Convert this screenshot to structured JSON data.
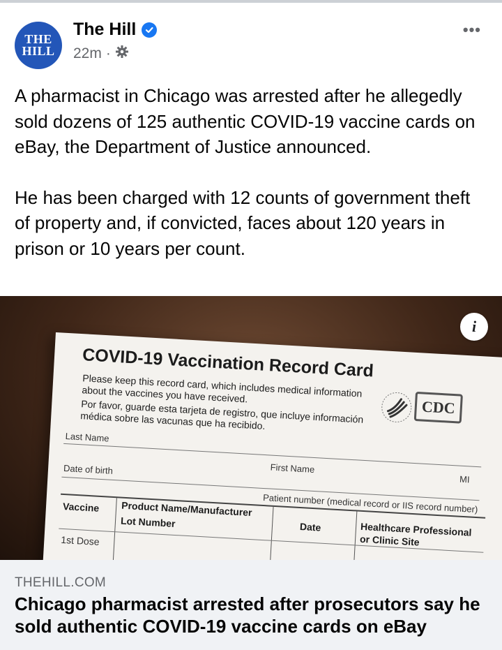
{
  "post": {
    "page_name": "The Hill",
    "avatar_line1": "THE",
    "avatar_line2": "HILL",
    "time": "22m",
    "more_label": "•••",
    "text_para1": "A pharmacist in Chicago was arrested after he allegedly sold dozens of 125 authentic COVID-19 vaccine cards on eBay, the Department of Justice announced.",
    "text_para2": "He has been charged with 12 counts of government theft of property and, if convicted, faces about 120 years in prison or 10 years per count."
  },
  "image": {
    "info_label": "i",
    "card_title": "COVID-19 Vaccination Record Card",
    "card_en": "Please keep this record card, which includes medical information about the vaccines you have received.",
    "card_es": "Por favor, guarde esta tarjeta de registro, que incluye información médica sobre las vacunas que ha recibido.",
    "cdc": "CDC",
    "last_name": "Last Name",
    "first_name": "First Name",
    "mi": "MI",
    "dob": "Date of birth",
    "patient_number": "Patient number (medical record or IIS record number)",
    "vaccine": "Vaccine",
    "product": "Product Name/Manufacturer",
    "lot": "Lot Number",
    "date": "Date",
    "provider": "Healthcare Professional or Clinic Site",
    "dose1": "1st Dose"
  },
  "link": {
    "domain": "THEHILL.COM",
    "headline": "Chicago pharmacist arrested after prosecutors say he sold authentic COVID-19 vaccine cards on eBay"
  },
  "colors": {
    "avatar_bg": "#2356b8",
    "verified": "#1877f2",
    "meta_text": "#65676b",
    "link_bg": "#f0f2f5"
  },
  "icons": {
    "verified": "verified-badge-icon",
    "privacy": "gear-globe-icon",
    "more": "more-options-icon",
    "info": "info-icon"
  }
}
